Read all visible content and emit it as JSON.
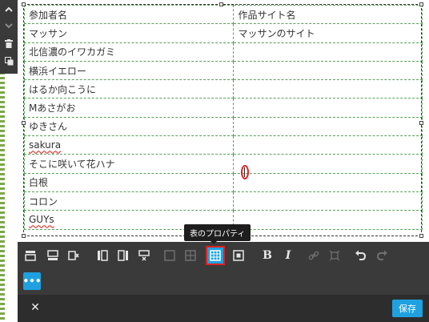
{
  "table": {
    "rows": [
      [
        "参加者名",
        "作品サイト名"
      ],
      [
        "マッサン",
        "マッサンのサイト"
      ],
      [
        "北信濃のイワカガミ",
        ""
      ],
      [
        "横浜イエロー",
        ""
      ],
      [
        "はるか向こうに",
        ""
      ],
      [
        "Mあさがお",
        ""
      ],
      [
        "ゆきさん",
        ""
      ],
      [
        "sakura",
        ""
      ],
      [
        "そこに咲いて花ハナ",
        ""
      ],
      [
        "白根",
        ""
      ],
      [
        "コロン",
        ""
      ],
      [
        "GUYs",
        ""
      ]
    ]
  },
  "tooltip": "表のプロパティ",
  "toolbar": {
    "bold_label": "B",
    "italic_label": "I",
    "more_label": "•••"
  },
  "footer": {
    "close_label": "✕",
    "save_label": "保存"
  },
  "colors": {
    "accent": "#1fa1df",
    "toolbar_bg": "#3a3a3a",
    "highlight": "#e02020"
  }
}
